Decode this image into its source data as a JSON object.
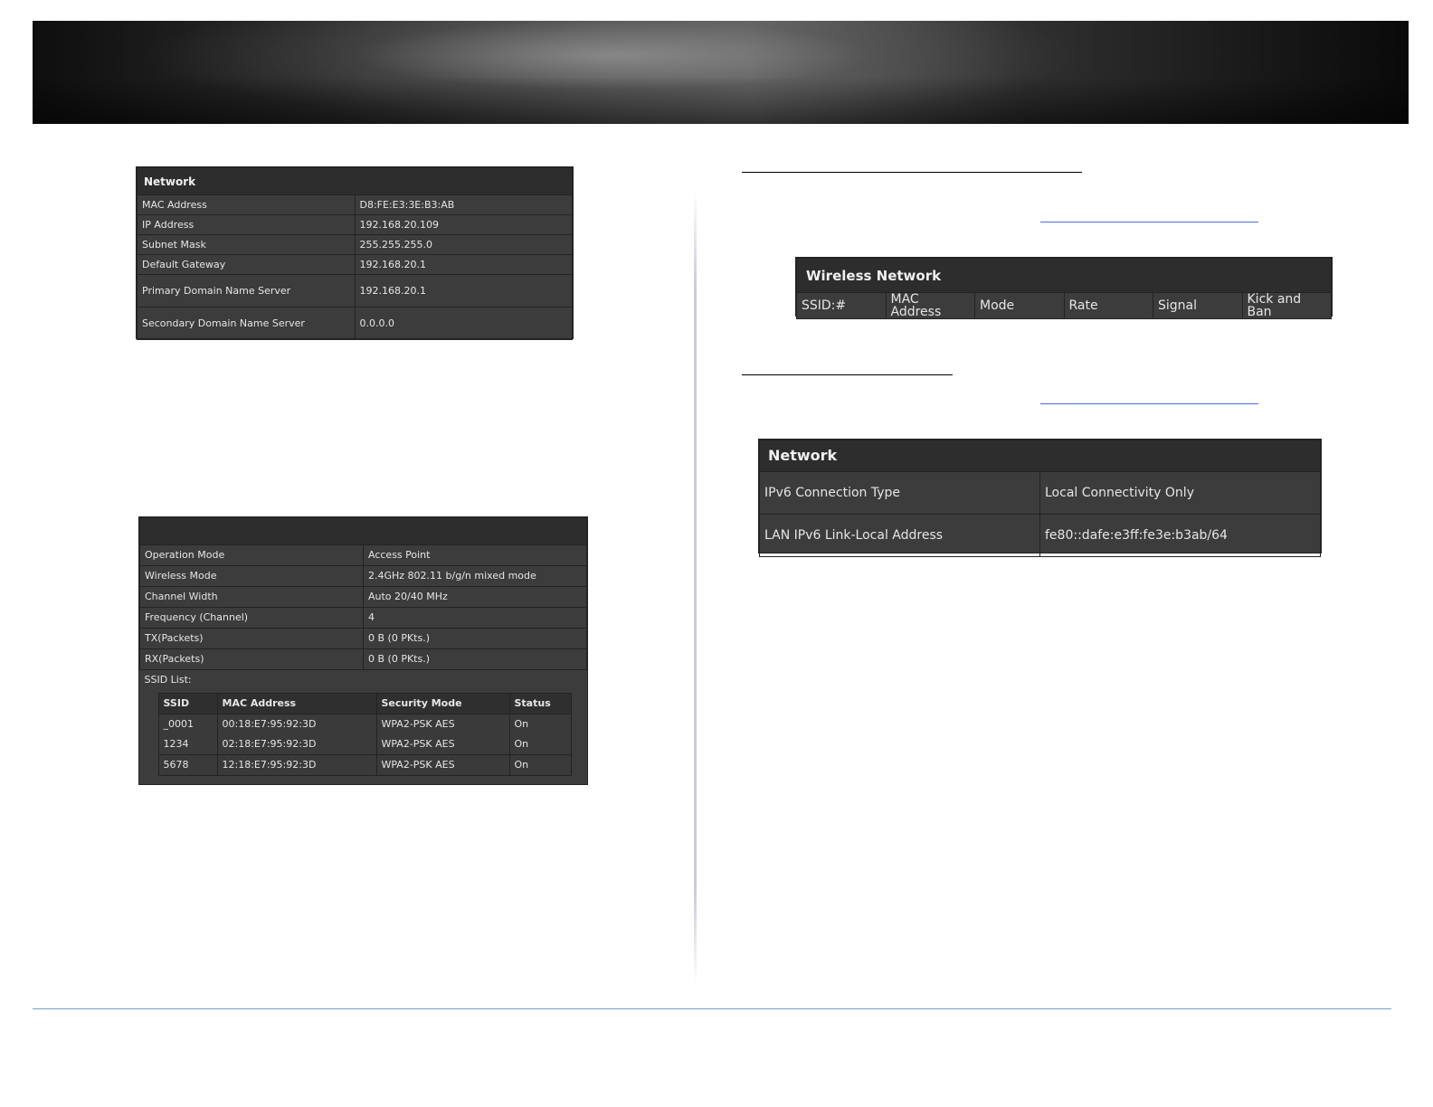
{
  "network_panel": {
    "title": "Network",
    "rows": [
      {
        "label": "MAC Address",
        "value": "D8:FE:E3:3E:B3:AB"
      },
      {
        "label": "IP Address",
        "value": "192.168.20.109"
      },
      {
        "label": "Subnet Mask",
        "value": "255.255.255.0"
      },
      {
        "label": "Default Gateway",
        "value": "192.168.20.1"
      },
      {
        "label": "Primary Domain Name Server",
        "value": "192.168.20.1"
      },
      {
        "label": "Secondary Domain Name Server",
        "value": "0.0.0.0"
      }
    ]
  },
  "wireless_panel": {
    "title": "",
    "rows": [
      {
        "label": "Operation Mode",
        "value": "Access Point"
      },
      {
        "label": "Wireless Mode",
        "value": "2.4GHz 802.11 b/g/n mixed mode"
      },
      {
        "label": "Channel Width",
        "value": "Auto 20/40 MHz"
      },
      {
        "label": "Frequency (Channel)",
        "value": "4"
      },
      {
        "label": "TX(Packets)",
        "value": "0 B (0 PKts.)"
      },
      {
        "label": "RX(Packets)",
        "value": "0 B (0 PKts.)"
      }
    ],
    "ssid_list_label": "SSID List:",
    "ssid_table": {
      "headers": [
        "SSID",
        "MAC Address",
        "Security Mode",
        "Status"
      ],
      "rows": [
        [
          "_0001",
          "00:18:E7:95:92:3D",
          "WPA2-PSK AES",
          "On"
        ],
        [
          "1234",
          "02:18:E7:95:92:3D",
          "WPA2-PSK AES",
          "On"
        ],
        [
          "5678",
          "12:18:E7:95:92:3D",
          "WPA2-PSK AES",
          "On"
        ]
      ]
    }
  },
  "wireless_network_panel": {
    "title": "Wireless Network",
    "headers": [
      "SSID:#",
      "MAC Address",
      "Mode",
      "Rate",
      "Signal",
      "Kick and Ban"
    ]
  },
  "ipv6_panel": {
    "title": "Network",
    "rows": [
      {
        "label": "IPv6 Connection Type",
        "value": "Local Connectivity Only"
      },
      {
        "label": "LAN IPv6 Link-Local Address",
        "value": "fe80::dafe:e3ff:fe3e:b3ab/64"
      }
    ]
  }
}
